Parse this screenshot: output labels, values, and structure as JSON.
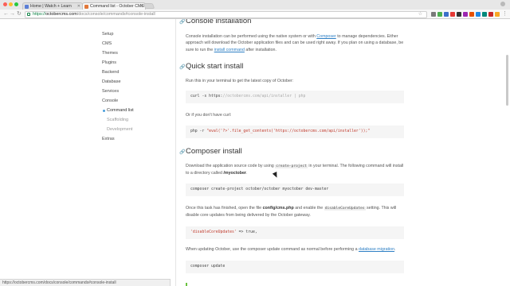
{
  "browser": {
    "tabs": [
      {
        "title": "Home | Watch + Learn",
        "favicon_color": "#5b7fd6",
        "active": false
      },
      {
        "title": "Command list - October CMS",
        "favicon_color": "#e2783a",
        "active": true
      }
    ],
    "url": {
      "scheme": "https://",
      "host": "octobercms.com",
      "path": "/docs/console/commands#console-install"
    },
    "status_url": "https://octobercms.com/docs/console/commands#console-install"
  },
  "sidebar": {
    "items": [
      {
        "label": "Setup"
      },
      {
        "label": "CMS"
      },
      {
        "label": "Themes"
      },
      {
        "label": "Plugins"
      },
      {
        "label": "Backend"
      },
      {
        "label": "Database"
      },
      {
        "label": "Services"
      },
      {
        "label": "Console"
      },
      {
        "label": "Command list"
      },
      {
        "label": "Scaffolding"
      },
      {
        "label": "Development"
      },
      {
        "label": "Extras"
      }
    ]
  },
  "content": {
    "s1": {
      "title": "Console installation",
      "p_a": "Console installation can be performed using the native system or with ",
      "p_link1": "Composer",
      "p_b": " to manage dependencies. Either approach will download the October application files and can be used right away. If you plan on using a database, be sure to run the ",
      "p_link2": "install command",
      "p_c": " after installation."
    },
    "s2": {
      "title": "Quick start install",
      "p1": "Run this in your terminal to get the latest copy of October:",
      "code1_cmd": "curl -s https:",
      "code1_comment": "//octobercms.com/api/installer | php",
      "p2": "Or if you don't have curl:",
      "code2_a": "php -r ",
      "code2_str": "\"eval('?>'.file_get_contents('https://octobercms.com/api/installer'));\""
    },
    "s3": {
      "title": "Composer install",
      "p1_a": "Download the application source code by using ",
      "p1_code": "create-project",
      "p1_b": " in your terminal. The following command will install to a directory called ",
      "p1_bold": "/myoctober",
      "p1_c": ".",
      "code1": "composer create-project october/october myoctober dev-master",
      "p2_a": "Once this task has finished, open the file ",
      "p2_bold": "config/cms.php",
      "p2_b": " and enable the ",
      "p2_code": "disableCoreUpdates",
      "p2_c": " setting. This will disable core updates from being delivered by the October gateway.",
      "code2_str": "'disableCoreUpdates'",
      "code2_rest": " => true,",
      "p3_a": "When updating October, use the composer update command as normal before performing a ",
      "p3_link": "database migration",
      "p3_b": ".",
      "code3": "composer update"
    }
  },
  "colors": {
    "link": "#2f80c5",
    "code_bg": "#f5f5f5",
    "nav_dot": "#4a9fdb"
  }
}
